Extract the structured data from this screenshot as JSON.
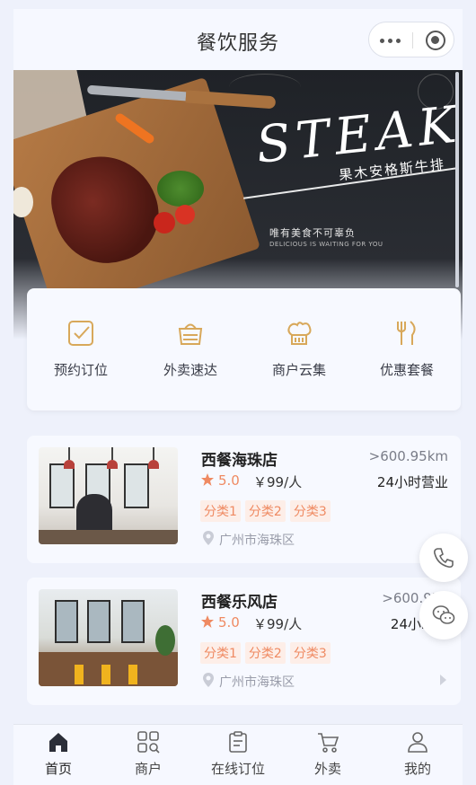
{
  "header": {
    "title": "餐饮服务"
  },
  "banner": {
    "headline": "STEAK",
    "subtitle": "果木安格斯牛排",
    "slogan_cn": "唯有美食不可辜负",
    "slogan_en": "DELICIOUS IS WAITING FOR YOU"
  },
  "quick_menu": [
    {
      "label": "预约订位",
      "icon": "checkbox-icon"
    },
    {
      "label": "外卖速达",
      "icon": "basket-icon"
    },
    {
      "label": "商户云集",
      "icon": "chef-hat-icon"
    },
    {
      "label": "优惠套餐",
      "icon": "fork-knife-icon"
    }
  ],
  "stores": [
    {
      "name": "西餐海珠店",
      "distance": ">600.95km",
      "rating": "5.0",
      "price": "￥99/人",
      "hours": "24小时营业",
      "tags": [
        "分类1",
        "分类2",
        "分类3"
      ],
      "location": "广州市海珠区"
    },
    {
      "name": "西餐乐风店",
      "distance": ">600.95k",
      "rating": "5.0",
      "price": "￥99/人",
      "hours": "24小时营",
      "tags": [
        "分类1",
        "分类2",
        "分类3"
      ],
      "location": "广州市海珠区"
    }
  ],
  "floating": {
    "phone_icon": "phone-icon",
    "wechat_icon": "wechat-icon"
  },
  "tabbar": [
    {
      "label": "首页",
      "icon": "home-icon",
      "active": true
    },
    {
      "label": "商户",
      "icon": "grid-search-icon",
      "active": false
    },
    {
      "label": "在线订位",
      "icon": "clipboard-icon",
      "active": false
    },
    {
      "label": "外卖",
      "icon": "cart-icon",
      "active": false
    },
    {
      "label": "我的",
      "icon": "user-icon",
      "active": false
    }
  ],
  "colors": {
    "accent": "#ef8a62",
    "icon_gold": "#d8a85a",
    "page_bg": "#eef1fb",
    "card_bg": "#f7f9ff"
  }
}
